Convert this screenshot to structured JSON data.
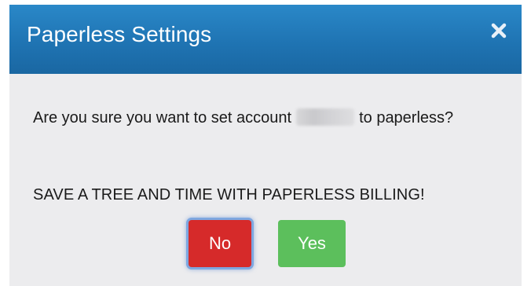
{
  "dialog": {
    "title": "Paperless Settings",
    "close_icon": "close-icon",
    "question_before": "Are you sure you want to set account",
    "question_after": "to paperless?",
    "promo": "SAVE A TREE AND TIME WITH PAPERLESS BILLING!",
    "buttons": {
      "no_label": "No",
      "yes_label": "Yes"
    }
  },
  "colors": {
    "header": "#1f74b3",
    "body_bg": "#ececee",
    "no_button": "#d62a2a",
    "yes_button": "#5cbf5c",
    "focus_ring": "#7ea7e0"
  }
}
